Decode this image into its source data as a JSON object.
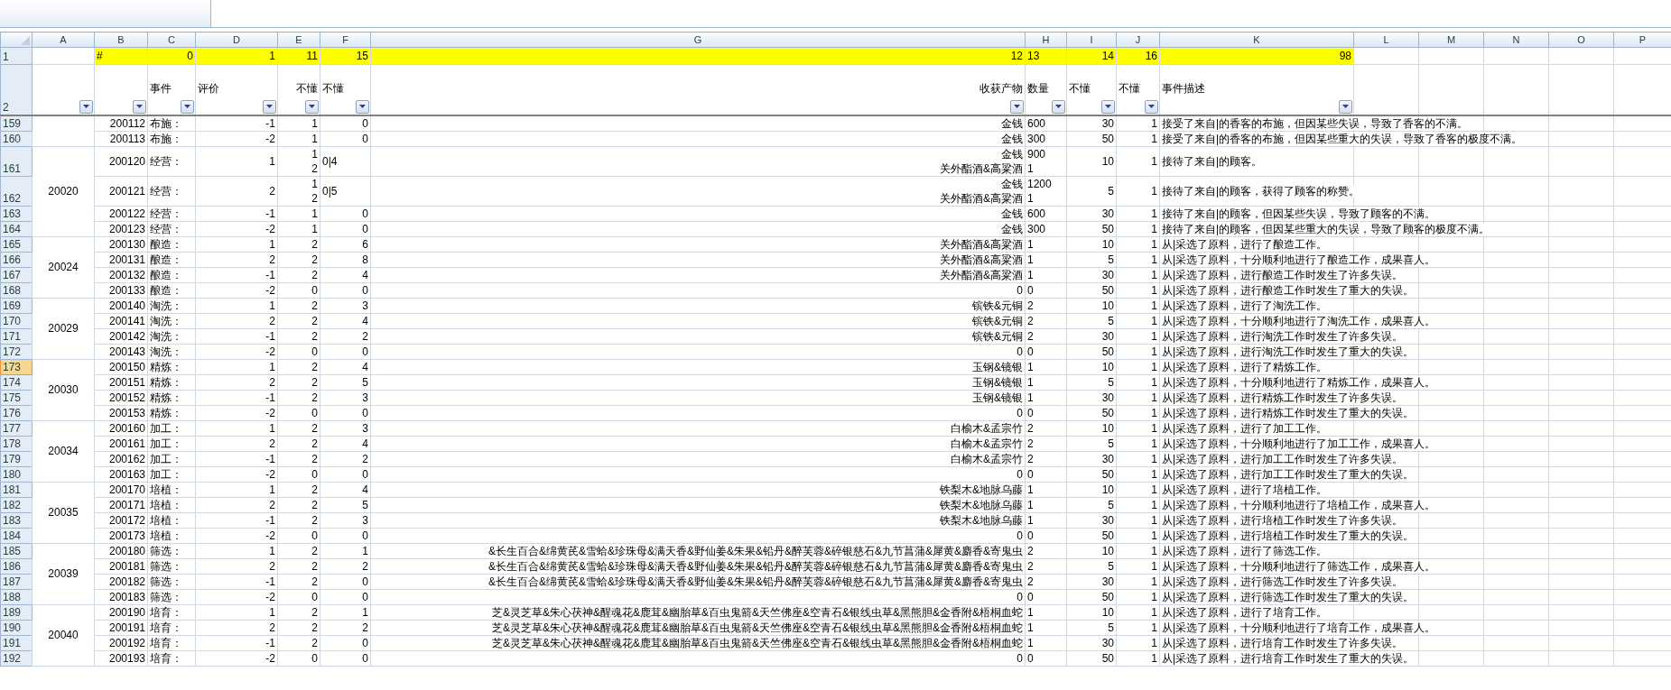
{
  "column_headers": [
    "A",
    "B",
    "C",
    "D",
    "E",
    "F",
    "G",
    "H",
    "I",
    "J",
    "K",
    "L",
    "M",
    "N",
    "O",
    "P"
  ],
  "key_row": {
    "number": "1",
    "b": "#",
    "c": "0",
    "d": "1",
    "e": "11",
    "f": "15",
    "g": "12",
    "h": "13",
    "i": "14",
    "j": "16",
    "k": "98"
  },
  "field_row": {
    "number": "2",
    "labels": [
      "事件",
      "评价",
      "不懂",
      "不懂",
      "收获产物",
      "数量",
      "不懂",
      "不懂",
      "事件描述"
    ]
  },
  "groups": [
    {
      "rows": [
        {
          "number": "159",
          "selected": false,
          "b": "200112",
          "c": "布施：",
          "d": "-1",
          "e": "1",
          "f": "0",
          "g": "金钱",
          "h": "600",
          "i": "30",
          "j": "1",
          "k": "接受了来自|的香客的布施，但因某些失误，导致了香客的不满。"
        },
        {
          "number": "160",
          "selected": false,
          "b": "200113",
          "c": "布施：",
          "d": "-2",
          "e": "1",
          "f": "0",
          "g": "金钱",
          "h": "300",
          "i": "50",
          "j": "1",
          "k": "接受了来自|的香客的布施，但因某些重大的失误，导致了香客的极度不满。"
        }
      ]
    },
    {
      "label": "20020",
      "rows": [
        {
          "number": "161",
          "selected": false,
          "b": "200120",
          "c": "经营：",
          "d": "1",
          "e": [
            "1",
            "2"
          ],
          "f": "0|4",
          "g": [
            "金钱",
            "关外酯酒&高粱酒"
          ],
          "h": [
            "900",
            "1"
          ],
          "i": "10",
          "j": "1",
          "k": "接待了来自|的顾客。"
        },
        {
          "number": "162",
          "selected": false,
          "b": "200121",
          "c": "经营：",
          "d": "2",
          "e": [
            "1",
            "2"
          ],
          "f": "0|5",
          "g": [
            "金钱",
            "关外酯酒&高粱酒"
          ],
          "h": [
            "1200",
            "1"
          ],
          "i": "5",
          "j": "1",
          "k": "接待了来自|的顾客，获得了顾客的称赞。"
        },
        {
          "number": "163",
          "selected": false,
          "b": "200122",
          "c": "经营：",
          "d": "-1",
          "e": "1",
          "f": "0",
          "g": "金钱",
          "h": "600",
          "i": "30",
          "j": "1",
          "k": "接待了来自|的顾客，但因某些失误，导致了顾客的不满。"
        },
        {
          "number": "164",
          "selected": false,
          "b": "200123",
          "c": "经营：",
          "d": "-2",
          "e": "1",
          "f": "0",
          "g": "金钱",
          "h": "300",
          "i": "50",
          "j": "1",
          "k": "接待了来自|的顾客，但因某些重大的失误，导致了顾客的极度不满。"
        }
      ]
    },
    {
      "label": "20024",
      "rows": [
        {
          "number": "165",
          "selected": false,
          "b": "200130",
          "c": "酿造：",
          "d": "1",
          "e": "2",
          "f": "6",
          "g": "关外酯酒&高粱酒",
          "h": "1",
          "i": "10",
          "j": "1",
          "k": "从|采选了原料，进行了酿造工作。"
        },
        {
          "number": "166",
          "selected": false,
          "b": "200131",
          "c": "酿造：",
          "d": "2",
          "e": "2",
          "f": "8",
          "g": "关外酯酒&高粱酒",
          "h": "1",
          "i": "5",
          "j": "1",
          "k": "从|采选了原料，十分顺利地进行了酿造工作，成果喜人。"
        },
        {
          "number": "167",
          "selected": false,
          "b": "200132",
          "c": "酿造：",
          "d": "-1",
          "e": "2",
          "f": "4",
          "g": "关外酯酒&高粱酒",
          "h": "1",
          "i": "30",
          "j": "1",
          "k": "从|采选了原料，进行酿造工作时发生了许多失误。"
        },
        {
          "number": "168",
          "selected": false,
          "b": "200133",
          "c": "酿造：",
          "d": "-2",
          "e": "0",
          "f": "0",
          "g": "0",
          "h": "0",
          "i": "50",
          "j": "1",
          "k": "从|采选了原料，进行酿造工作时发生了重大的失误。"
        }
      ]
    },
    {
      "label": "20029",
      "rows": [
        {
          "number": "169",
          "selected": false,
          "b": "200140",
          "c": "淘洗：",
          "d": "1",
          "e": "2",
          "f": "3",
          "g": "镔铁&元铜",
          "h": "2",
          "i": "10",
          "j": "1",
          "k": "从|采选了原料，进行了淘洗工作。"
        },
        {
          "number": "170",
          "selected": false,
          "b": "200141",
          "c": "淘洗：",
          "d": "2",
          "e": "2",
          "f": "4",
          "g": "镔铁&元铜",
          "h": "2",
          "i": "5",
          "j": "1",
          "k": "从|采选了原料，十分顺利地进行了淘洗工作，成果喜人。"
        },
        {
          "number": "171",
          "selected": false,
          "b": "200142",
          "c": "淘洗：",
          "d": "-1",
          "e": "2",
          "f": "2",
          "g": "镔铁&元铜",
          "h": "2",
          "i": "30",
          "j": "1",
          "k": "从|采选了原料，进行淘洗工作时发生了许多失误。"
        },
        {
          "number": "172",
          "selected": false,
          "b": "200143",
          "c": "淘洗：",
          "d": "-2",
          "e": "0",
          "f": "0",
          "g": "0",
          "h": "0",
          "i": "50",
          "j": "1",
          "k": "从|采选了原料，进行淘洗工作时发生了重大的失误。"
        }
      ]
    },
    {
      "label": "20030",
      "rows": [
        {
          "number": "173",
          "selected": true,
          "b": "200150",
          "c": "精炼：",
          "d": "1",
          "e": "2",
          "f": "4",
          "g": "玉钢&镜银",
          "h": "1",
          "i": "10",
          "j": "1",
          "k": "从|采选了原料，进行了精炼工作。"
        },
        {
          "number": "174",
          "selected": false,
          "b": "200151",
          "c": "精炼：",
          "d": "2",
          "e": "2",
          "f": "5",
          "g": "玉钢&镜银",
          "h": "1",
          "i": "5",
          "j": "1",
          "k": "从|采选了原料，十分顺利地进行了精炼工作，成果喜人。"
        },
        {
          "number": "175",
          "selected": false,
          "b": "200152",
          "c": "精炼：",
          "d": "-1",
          "e": "2",
          "f": "3",
          "g": "玉钢&镜银",
          "h": "1",
          "i": "30",
          "j": "1",
          "k": "从|采选了原料，进行精炼工作时发生了许多失误。"
        },
        {
          "number": "176",
          "selected": false,
          "b": "200153",
          "c": "精炼：",
          "d": "-2",
          "e": "0",
          "f": "0",
          "g": "0",
          "h": "0",
          "i": "50",
          "j": "1",
          "k": "从|采选了原料，进行精炼工作时发生了重大的失误。"
        }
      ]
    },
    {
      "label": "20034",
      "rows": [
        {
          "number": "177",
          "selected": false,
          "b": "200160",
          "c": "加工：",
          "d": "1",
          "e": "2",
          "f": "3",
          "g": "白榆木&孟宗竹",
          "h": "2",
          "i": "10",
          "j": "1",
          "k": "从|采选了原料，进行了加工工作。"
        },
        {
          "number": "178",
          "selected": false,
          "b": "200161",
          "c": "加工：",
          "d": "2",
          "e": "2",
          "f": "4",
          "g": "白榆木&孟宗竹",
          "h": "2",
          "i": "5",
          "j": "1",
          "k": "从|采选了原料，十分顺利地进行了加工工作，成果喜人。"
        },
        {
          "number": "179",
          "selected": false,
          "b": "200162",
          "c": "加工：",
          "d": "-1",
          "e": "2",
          "f": "2",
          "g": "白榆木&孟宗竹",
          "h": "2",
          "i": "30",
          "j": "1",
          "k": "从|采选了原料，进行加工工作时发生了许多失误。"
        },
        {
          "number": "180",
          "selected": false,
          "b": "200163",
          "c": "加工：",
          "d": "-2",
          "e": "0",
          "f": "0",
          "g": "0",
          "h": "0",
          "i": "50",
          "j": "1",
          "k": "从|采选了原料，进行加工工作时发生了重大的失误。"
        }
      ]
    },
    {
      "label": "20035",
      "rows": [
        {
          "number": "181",
          "selected": false,
          "b": "200170",
          "c": "培植：",
          "d": "1",
          "e": "2",
          "f": "4",
          "g": "铁梨木&地脉乌藤",
          "h": "1",
          "i": "10",
          "j": "1",
          "k": "从|采选了原料，进行了培植工作。"
        },
        {
          "number": "182",
          "selected": false,
          "b": "200171",
          "c": "培植：",
          "d": "2",
          "e": "2",
          "f": "5",
          "g": "铁梨木&地脉乌藤",
          "h": "1",
          "i": "5",
          "j": "1",
          "k": "从|采选了原料，十分顺利地进行了培植工作，成果喜人。"
        },
        {
          "number": "183",
          "selected": false,
          "b": "200172",
          "c": "培植：",
          "d": "-1",
          "e": "2",
          "f": "3",
          "g": "铁梨木&地脉乌藤",
          "h": "1",
          "i": "30",
          "j": "1",
          "k": "从|采选了原料，进行培植工作时发生了许多失误。"
        },
        {
          "number": "184",
          "selected": false,
          "b": "200173",
          "c": "培植：",
          "d": "-2",
          "e": "0",
          "f": "0",
          "g": "0",
          "h": "0",
          "i": "50",
          "j": "1",
          "k": "从|采选了原料，进行培植工作时发生了重大的失误。"
        }
      ]
    },
    {
      "label": "20039",
      "rows": [
        {
          "number": "185",
          "selected": false,
          "b": "200180",
          "c": "筛选：",
          "d": "1",
          "e": "2",
          "f": "1",
          "g": "&长生百合&绵黄芪&雪蛤&珍珠母&满天香&野仙姜&朱果&铅丹&醉芙蓉&碎银慈石&九节菖蒲&犀黄&麝香&寄鬼虫",
          "h": "2",
          "i": "10",
          "j": "1",
          "k": "从|采选了原料，进行了筛选工作。"
        },
        {
          "number": "186",
          "selected": false,
          "b": "200181",
          "c": "筛选：",
          "d": "2",
          "e": "2",
          "f": "2",
          "g": "&长生百合&绵黄芪&雪蛤&珍珠母&满天香&野仙姜&朱果&铅丹&醉芙蓉&碎银慈石&九节菖蒲&犀黄&麝香&寄鬼虫",
          "h": "2",
          "i": "5",
          "j": "1",
          "k": "从|采选了原料，十分顺利地进行了筛选工作，成果喜人。"
        },
        {
          "number": "187",
          "selected": false,
          "b": "200182",
          "c": "筛选：",
          "d": "-1",
          "e": "2",
          "f": "0",
          "g": "&长生百合&绵黄芪&雪蛤&珍珠母&满天香&野仙姜&朱果&铅丹&醉芙蓉&碎银慈石&九节菖蒲&犀黄&麝香&寄鬼虫",
          "h": "2",
          "i": "30",
          "j": "1",
          "k": "从|采选了原料，进行筛选工作时发生了许多失误。"
        },
        {
          "number": "188",
          "selected": false,
          "b": "200183",
          "c": "筛选：",
          "d": "-2",
          "e": "0",
          "f": "0",
          "g": "0",
          "h": "0",
          "i": "50",
          "j": "1",
          "k": "从|采选了原料，进行筛选工作时发生了重大的失误。"
        }
      ]
    },
    {
      "label": "20040",
      "rows": [
        {
          "number": "189",
          "selected": false,
          "b": "200190",
          "c": "培育：",
          "d": "1",
          "e": "2",
          "f": "1",
          "g": "芝&灵芝草&朱心茯神&醒魂花&鹿茸&幽胎草&百虫鬼箭&天竺佛座&空青石&银线虫草&黑熊胆&金香附&梧桐血蛇",
          "h": "1",
          "i": "10",
          "j": "1",
          "k": "从|采选了原料，进行了培育工作。"
        },
        {
          "number": "190",
          "selected": false,
          "b": "200191",
          "c": "培育：",
          "d": "2",
          "e": "2",
          "f": "2",
          "g": "芝&灵芝草&朱心茯神&醒魂花&鹿茸&幽胎草&百虫鬼箭&天竺佛座&空青石&银线虫草&黑熊胆&金香附&梧桐血蛇",
          "h": "1",
          "i": "5",
          "j": "1",
          "k": "从|采选了原料，十分顺利地进行了培育工作，成果喜人。"
        },
        {
          "number": "191",
          "selected": false,
          "b": "200192",
          "c": "培育：",
          "d": "-1",
          "e": "2",
          "f": "0",
          "g": "芝&灵芝草&朱心茯神&醒魂花&鹿茸&幽胎草&百虫鬼箭&天竺佛座&空青石&银线虫草&黑熊胆&金香附&梧桐血蛇",
          "h": "1",
          "i": "30",
          "j": "1",
          "k": "从|采选了原料，进行培育工作时发生了许多失误。"
        },
        {
          "number": "192",
          "selected": false,
          "b": "200193",
          "c": "培育：",
          "d": "-2",
          "e": "0",
          "f": "0",
          "g": "0",
          "h": "0",
          "i": "50",
          "j": "1",
          "k": "从|采选了原料，进行培育工作时发生了重大的失误。"
        }
      ]
    }
  ]
}
